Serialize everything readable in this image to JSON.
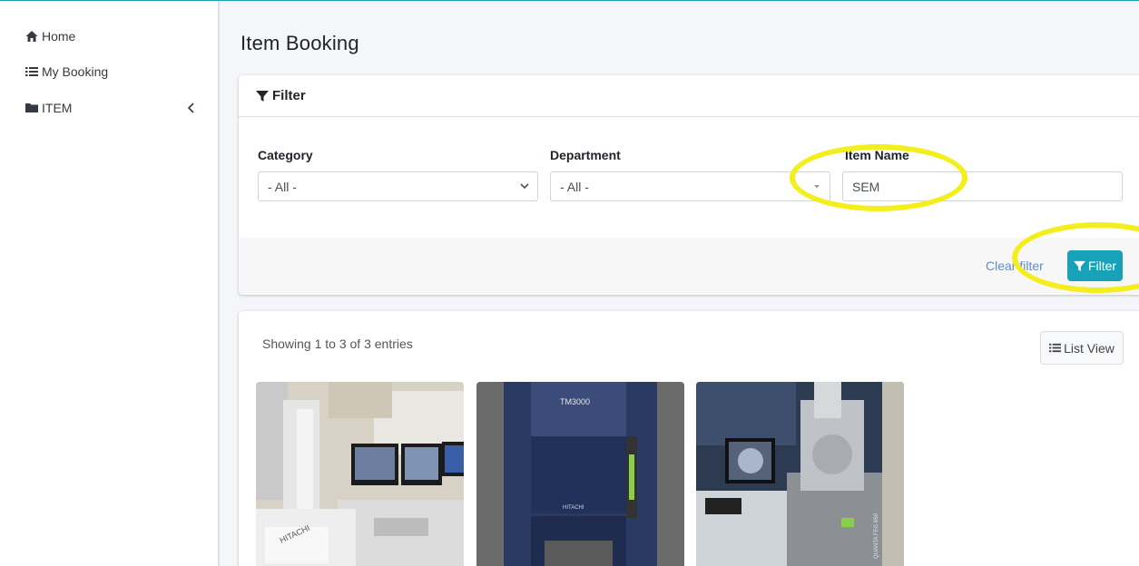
{
  "sidebar": {
    "items": [
      {
        "label": "Home",
        "icon": "home-icon"
      },
      {
        "label": "My Booking",
        "icon": "list-icon"
      },
      {
        "label": "ITEM",
        "icon": "folder-icon"
      }
    ]
  },
  "page": {
    "title": "Item Booking"
  },
  "filter": {
    "header": "Filter",
    "category": {
      "label": "Category",
      "value": "- All -"
    },
    "department": {
      "label": "Department",
      "value": "- All -"
    },
    "item_name": {
      "label": "Item Name",
      "value": "SEM"
    },
    "clear_label": "Clear filter",
    "button_label": "Filter"
  },
  "results": {
    "showing": "Showing 1 to 3 of 3 entries",
    "list_view_label": "List View",
    "items": [
      {
        "brand_text": "HITACHI"
      },
      {
        "model_text": "TM3000",
        "brand_text": "HITACHI"
      },
      {
        "side_text": "QUANTA FEG 650"
      }
    ]
  },
  "colors": {
    "accent": "#17a2b8",
    "highlight": "#f3ee1c",
    "link": "#5b8fd1"
  }
}
